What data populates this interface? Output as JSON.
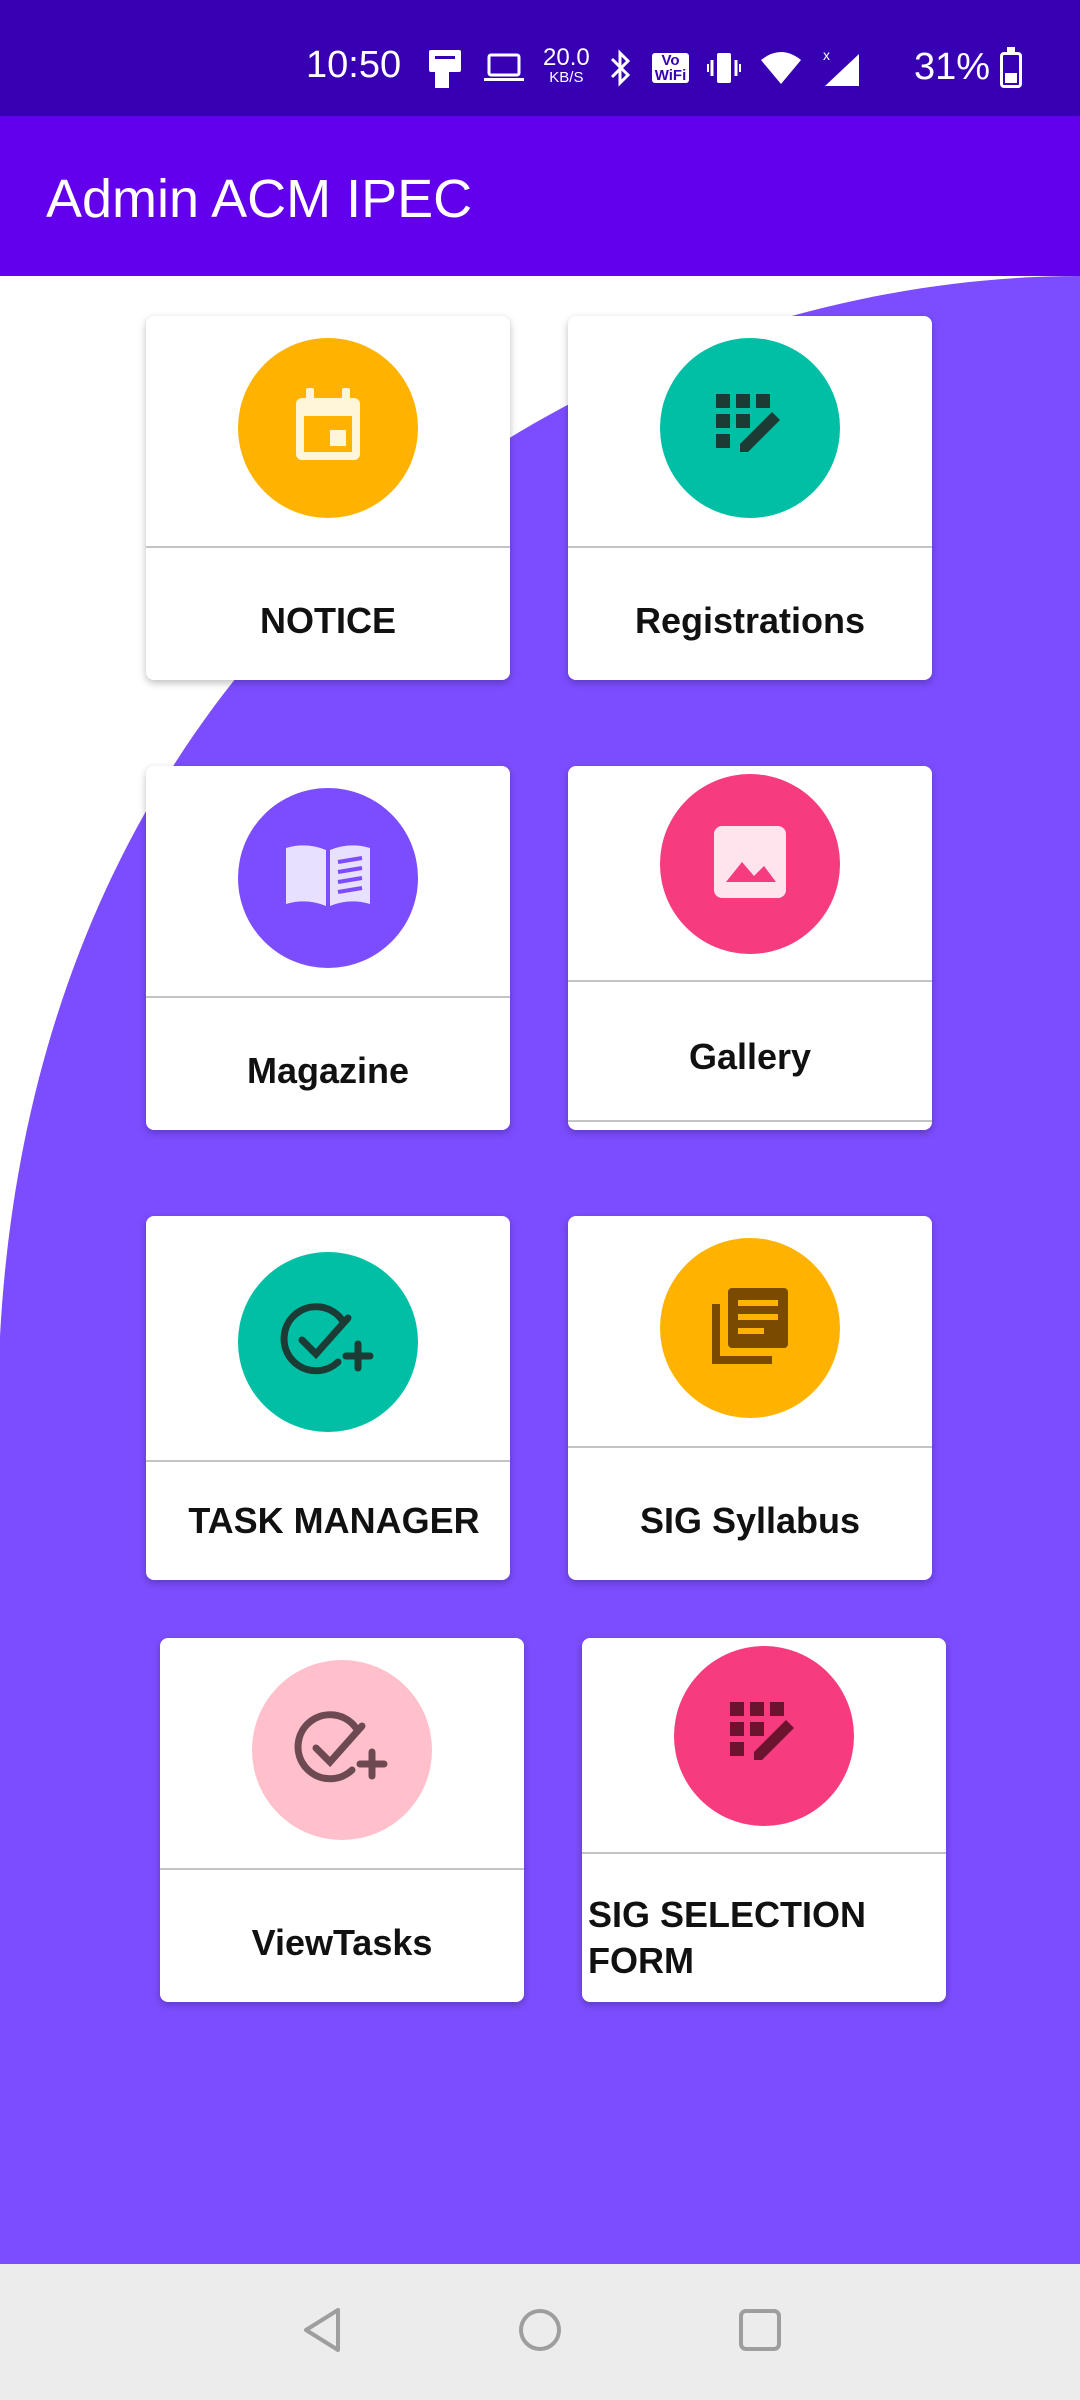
{
  "status_bar": {
    "time": "10:50",
    "speed_value": "20.0",
    "speed_unit": "KB/S",
    "vowifi_top": "Vo",
    "vowifi_bottom": "WiFi",
    "battery": "31%",
    "icons": [
      "data-saver-icon",
      "laptop-icon",
      "bluetooth-icon",
      "vowifi-icon",
      "vibrate-icon",
      "wifi-icon",
      "signal-icon",
      "battery-icon"
    ]
  },
  "app_bar": {
    "title": "Admin ACM IPEC"
  },
  "cards": [
    {
      "label": "NOTICE",
      "icon": "calendar-icon",
      "color": "#ffb300"
    },
    {
      "label": "Registrations",
      "icon": "edit-grid-icon",
      "color": "#00bfa5"
    },
    {
      "label": "Magazine",
      "icon": "book-icon",
      "color": "#7c4dff"
    },
    {
      "label": "Gallery",
      "icon": "image-icon",
      "color": "#f73b7f"
    },
    {
      "label": "TASK MANAGER",
      "icon": "task-add-icon",
      "color": "#00bfa5"
    },
    {
      "label": "SIG Syllabus",
      "icon": "library-books-icon",
      "color": "#ffb300"
    },
    {
      "label": "ViewTasks",
      "icon": "task-add-icon",
      "color": "#ffc0cb"
    },
    {
      "label": "SIG SELECTION FORM",
      "icon": "edit-grid-icon",
      "color": "#f73b7f"
    }
  ],
  "theme": {
    "primary": "#6200ee",
    "primary_dark": "#3700b3",
    "background_accent": "#7c4dff"
  },
  "nav_bar": {
    "icons": [
      "back-icon",
      "home-icon",
      "recents-icon"
    ]
  }
}
